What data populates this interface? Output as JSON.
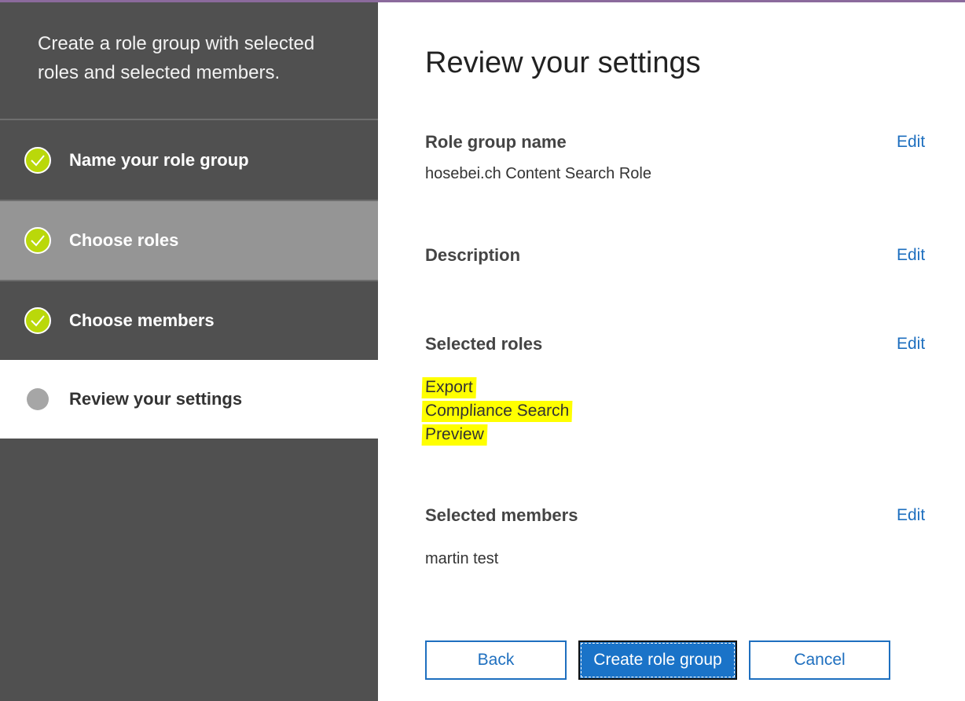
{
  "wizard": {
    "description": "Create a role group with selected roles and selected members.",
    "steps": [
      {
        "label": "Name your role group",
        "status": "complete"
      },
      {
        "label": "Choose roles",
        "status": "complete"
      },
      {
        "label": "Choose members",
        "status": "complete"
      },
      {
        "label": "Review your settings",
        "status": "current"
      }
    ]
  },
  "main": {
    "title": "Review your settings",
    "sections": {
      "role_group_name": {
        "heading": "Role group name",
        "edit": "Edit",
        "value": "hosebei.ch Content Search Role"
      },
      "description": {
        "heading": "Description",
        "edit": "Edit"
      },
      "selected_roles": {
        "heading": "Selected roles",
        "edit": "Edit",
        "roles": [
          "Export",
          "Compliance Search",
          "Preview"
        ]
      },
      "selected_members": {
        "heading": "Selected members",
        "edit": "Edit",
        "value": "martin test"
      }
    },
    "buttons": {
      "back": "Back",
      "create": "Create role group",
      "cancel": "Cancel"
    }
  },
  "colors": {
    "sidebar_bg": "#505050",
    "hover_step_bg": "#959595",
    "check_green": "#bad80a",
    "link_blue": "#1e6fbf",
    "primary_blue": "#1a73c8",
    "highlight_yellow": "#ffff00"
  }
}
